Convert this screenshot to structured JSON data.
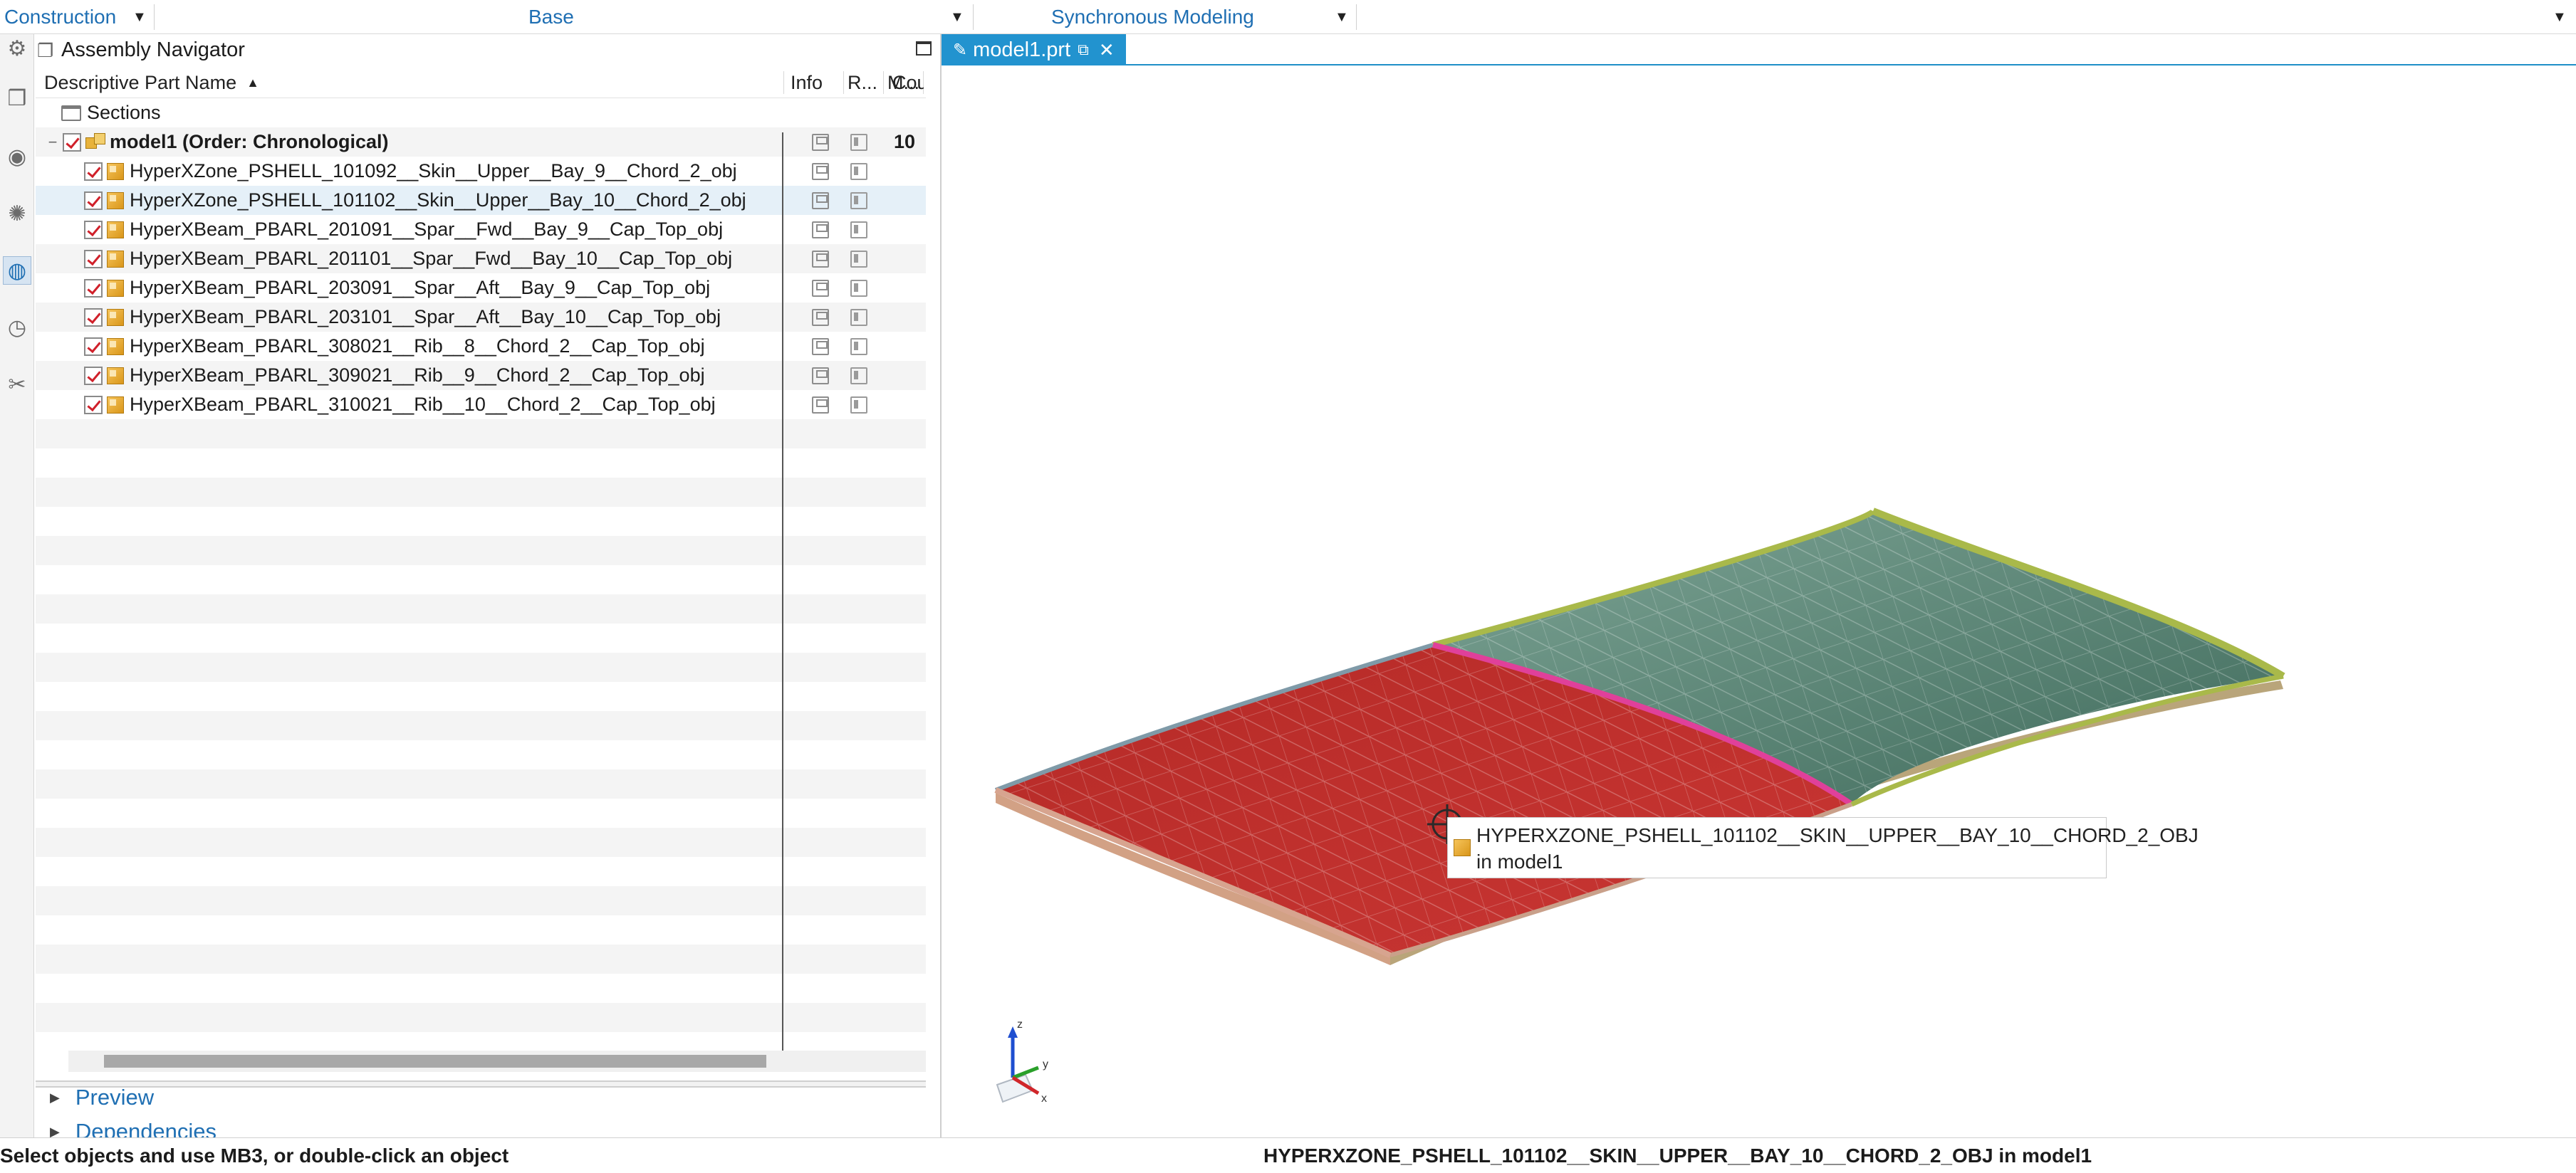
{
  "topbar": {
    "construction": "Construction",
    "base": "Base",
    "modeling": "Synchronous Modeling"
  },
  "navigator": {
    "title": "Assembly Navigator",
    "columns": {
      "name": "Descriptive Part Name",
      "info": "Info",
      "r": "R...",
      "m": "M...",
      "count": "Cou"
    },
    "sections_label": "Sections",
    "root": {
      "label": "model1 (Order: Chronological)",
      "count": "10"
    },
    "parts": [
      "HyperXZone_PSHELL_101092__Skin__Upper__Bay_9__Chord_2_obj",
      "HyperXZone_PSHELL_101102__Skin__Upper__Bay_10__Chord_2_obj",
      "HyperXBeam_PBARL_201091__Spar__Fwd__Bay_9__Cap_Top_obj",
      "HyperXBeam_PBARL_201101__Spar__Fwd__Bay_10__Cap_Top_obj",
      "HyperXBeam_PBARL_203091__Spar__Aft__Bay_9__Cap_Top_obj",
      "HyperXBeam_PBARL_203101__Spar__Aft__Bay_10__Cap_Top_obj",
      "HyperXBeam_PBARL_308021__Rib__8__Chord_2__Cap_Top_obj",
      "HyperXBeam_PBARL_309021__Rib__9__Chord_2__Cap_Top_obj",
      "HyperXBeam_PBARL_310021__Rib__10__Chord_2__Cap_Top_obj"
    ],
    "preview": "Preview",
    "dependencies": "Dependencies"
  },
  "graphics": {
    "tab_label": "model1.prt",
    "tooltip_line1": "HYPERXZONE_PSHELL_101102__SKIN__UPPER__BAY_10__CHORD_2_OBJ",
    "tooltip_line2": "in model1"
  },
  "status": {
    "left": "Select objects and use MB3, or double-click an object",
    "right": "HYPERXZONE_PSHELL_101102__SKIN__UPPER__BAY_10__CHORD_2_OBJ in model1"
  },
  "colors": {
    "accent": "#1f6fb3",
    "tab": "#2293cf",
    "skin_highlight": "#c0302e",
    "skin_other": "#5f8a78",
    "edge_green": "#a9b94a",
    "edge_magenta": "#e0409a"
  },
  "icons": [
    "settings-icon",
    "assembly-icon",
    "part-nav-icon",
    "constraint-icon",
    "web-icon",
    "history-icon",
    "tools-icon",
    "folder-icon",
    "part-icon",
    "save-icon",
    "model-icon"
  ]
}
